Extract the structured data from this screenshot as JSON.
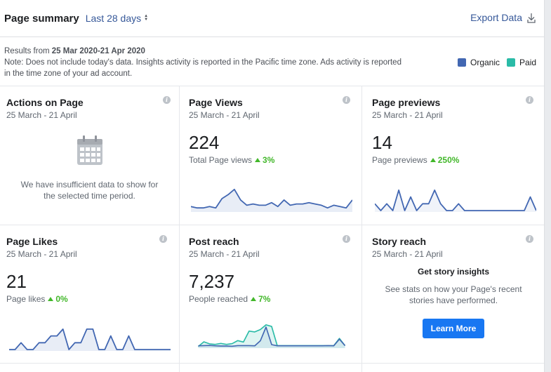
{
  "header": {
    "title": "Page summary",
    "range_label": "Last 28 days",
    "export_label": "Export Data"
  },
  "note": {
    "results_prefix": "Results from",
    "results_range": "25 Mar 2020-21 Apr 2020",
    "line1": "Note: Does not include today's data. Insights activity is reported in the Pacific time zone. Ads activity is reported",
    "line2": "in the time zone of your ad account."
  },
  "legend": {
    "organic": {
      "label": "Organic",
      "color": "#4267b2"
    },
    "paid": {
      "label": "Paid",
      "color": "#2abba7"
    }
  },
  "cards": {
    "actions": {
      "title": "Actions on Page",
      "date": "25 March - 21 April",
      "empty_line1": "We have insufficient data to show for",
      "empty_line2": "the selected time period."
    },
    "views": {
      "title": "Page Views",
      "date": "25 March - 21 April",
      "value": "224",
      "sub": "Total Page views",
      "delta": "3%",
      "organic": [
        3,
        2,
        2,
        3,
        2,
        9,
        12,
        16,
        8,
        4,
        5,
        4,
        4,
        6,
        3,
        8,
        4,
        5,
        5,
        6,
        5,
        4,
        2,
        4,
        3,
        2,
        8
      ],
      "ymax": 18
    },
    "previews": {
      "title": "Page previews",
      "date": "25 March - 21 April",
      "value": "14",
      "sub": "Page previews",
      "delta": "250%",
      "organic": [
        1,
        0,
        1,
        0,
        3,
        0,
        2,
        0,
        1,
        1,
        3,
        1,
        0,
        0,
        1,
        0,
        0,
        0,
        0,
        0,
        0,
        0,
        0,
        0,
        0,
        0,
        2,
        0
      ],
      "ymax": 3.5
    },
    "likes": {
      "title": "Page Likes",
      "date": "25 March - 21 April",
      "value": "21",
      "sub": "Page likes",
      "delta": "0%",
      "organic": [
        0,
        0,
        1,
        0,
        0,
        1,
        1,
        2,
        2,
        3,
        0,
        1,
        1,
        3,
        3,
        0,
        0,
        2,
        0,
        0,
        2,
        0,
        0,
        0,
        0,
        0,
        0,
        0
      ],
      "ymax": 3.5
    },
    "reach": {
      "title": "Post reach",
      "date": "25 March - 21 April",
      "value": "7,237",
      "sub": "People reached",
      "delta": "7%",
      "organic": [
        50,
        60,
        70,
        50,
        40,
        40,
        30,
        60,
        60,
        60,
        50,
        300,
        980,
        110,
        50,
        50,
        50,
        50,
        50,
        50,
        50,
        50,
        50,
        60,
        50,
        380,
        60
      ],
      "paid": [
        20,
        250,
        150,
        120,
        170,
        120,
        160,
        310,
        240,
        780,
        740,
        860,
        1090,
        1010,
        60,
        60,
        60,
        60,
        60,
        60,
        60,
        60,
        60,
        60,
        60,
        420,
        60
      ],
      "ymax": 1200
    },
    "story": {
      "title": "Story reach",
      "date": "25 March - 21 April",
      "heading": "Get story insights",
      "desc_line1": "See stats on how your Page's recent",
      "desc_line2": "stories have performed.",
      "button": "Learn More"
    }
  }
}
